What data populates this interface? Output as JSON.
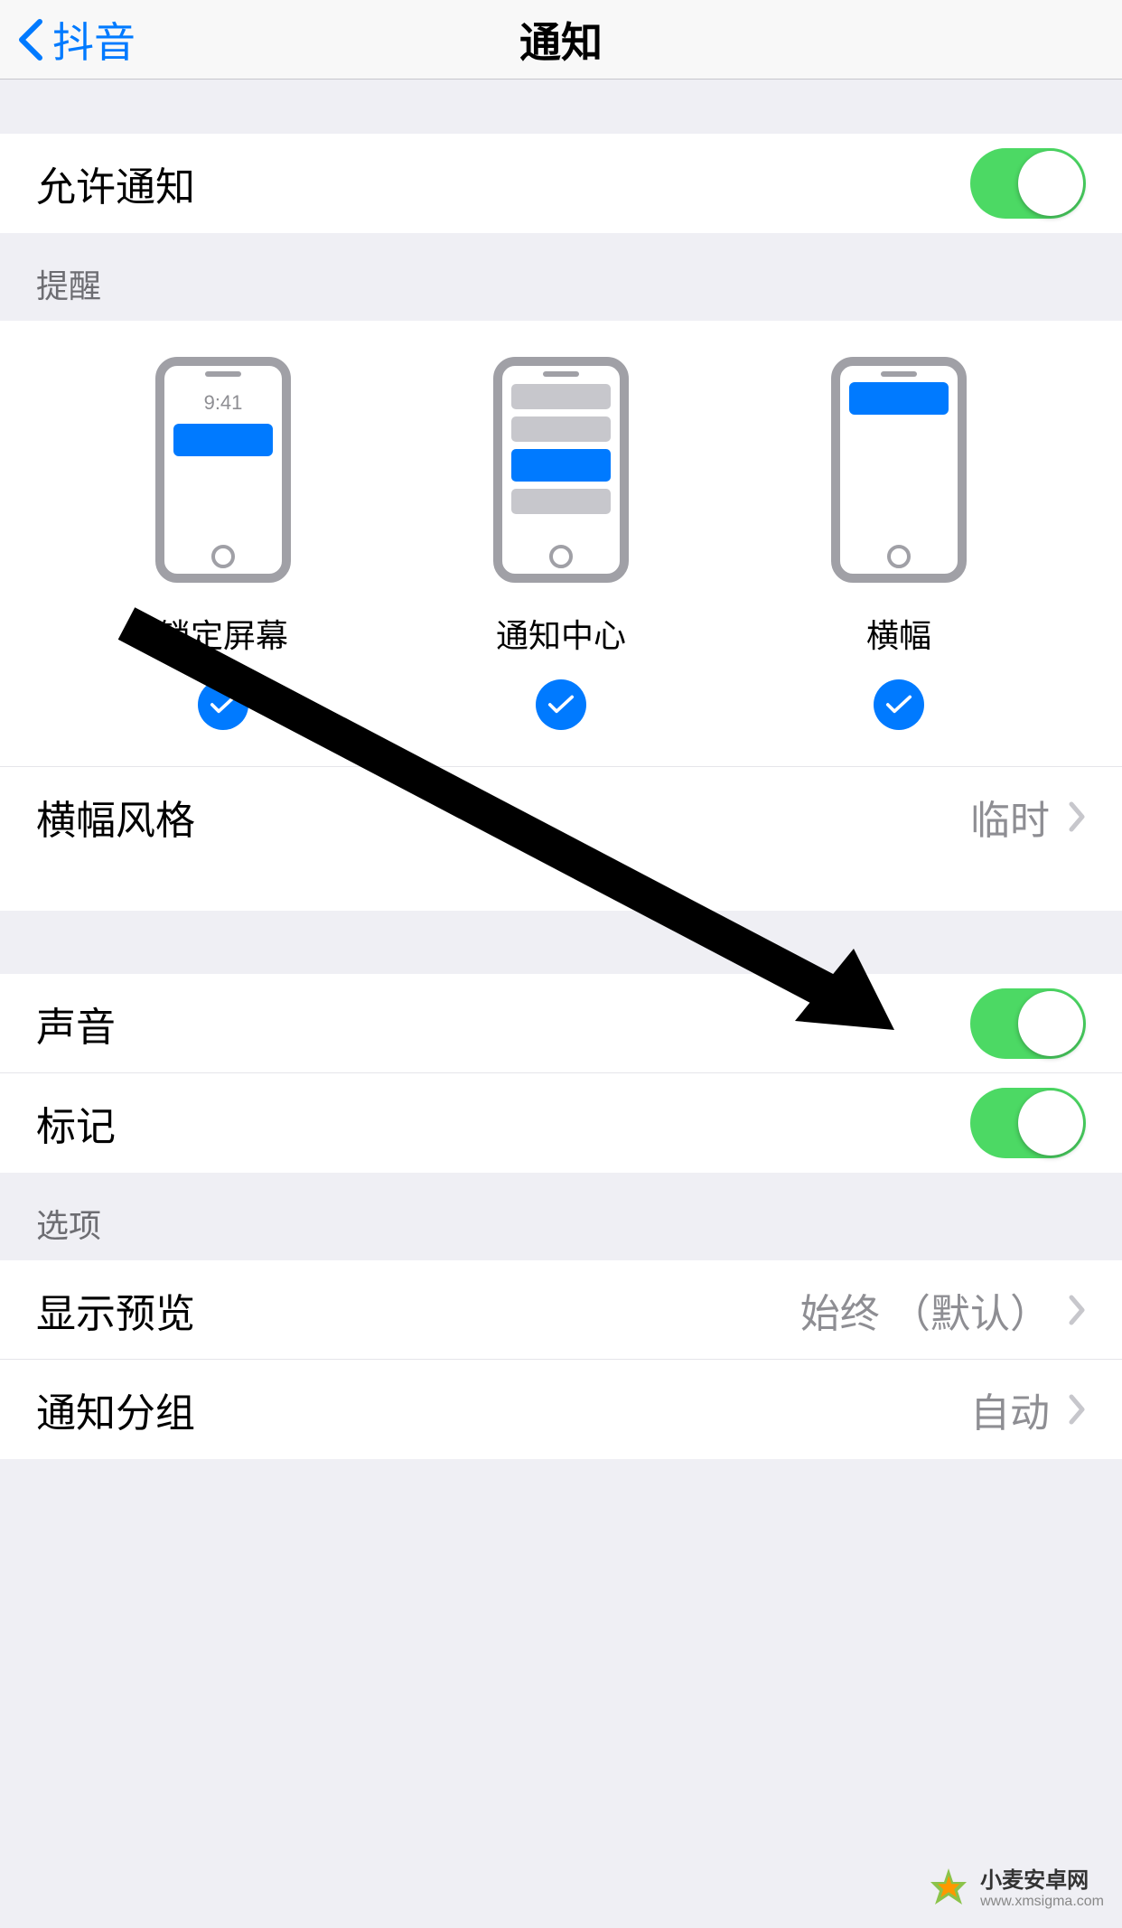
{
  "nav": {
    "back_label": "抖音",
    "title": "通知"
  },
  "allow_notifications": {
    "label": "允许通知",
    "enabled": true
  },
  "alerts": {
    "header": "提醒",
    "lock_screen": {
      "label": "锁定屏幕",
      "time_display": "9:41",
      "selected": true
    },
    "notification_center": {
      "label": "通知中心",
      "selected": true
    },
    "banners": {
      "label": "横幅",
      "selected": true
    },
    "banner_style": {
      "label": "横幅风格",
      "value": "临时"
    }
  },
  "sounds": {
    "label": "声音",
    "enabled": true
  },
  "badges": {
    "label": "标记",
    "enabled": true
  },
  "options": {
    "header": "选项",
    "show_previews": {
      "label": "显示预览",
      "value": "始终 （默认）"
    },
    "grouping": {
      "label": "通知分组",
      "value": "自动"
    }
  },
  "watermark": {
    "title": "小麦安卓网",
    "url": "www.xmsigma.com"
  }
}
